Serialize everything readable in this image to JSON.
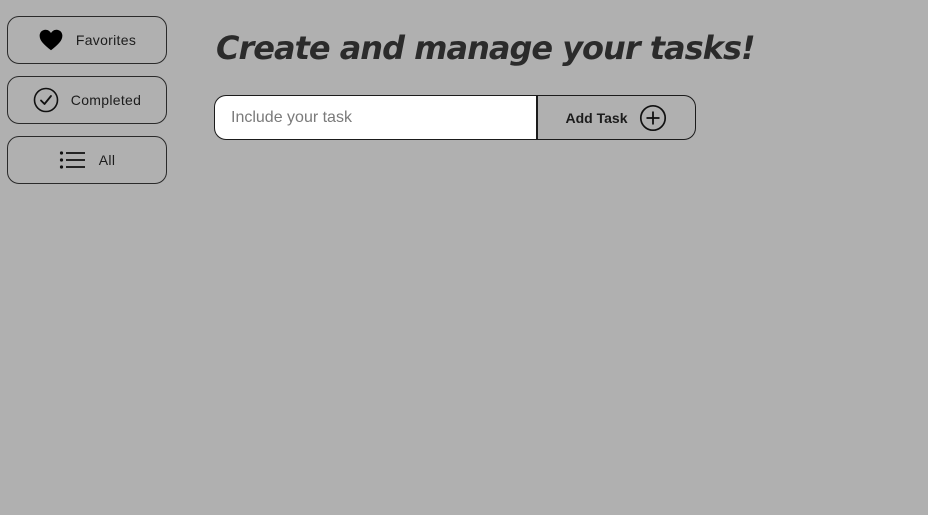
{
  "sidebar": {
    "items": [
      {
        "label": "Favorites",
        "icon": "heart-icon"
      },
      {
        "label": "Completed",
        "icon": "check-circle-icon"
      },
      {
        "label": "All",
        "icon": "list-icon"
      }
    ]
  },
  "main": {
    "title": "Create and manage your tasks!",
    "task_input": {
      "placeholder": "Include your task",
      "value": ""
    },
    "add_button": {
      "label": "Add Task",
      "icon": "plus-circle-icon"
    }
  },
  "colors": {
    "background": "#b0b0b0",
    "text": "#1f1f1f",
    "input_background": "#ffffff",
    "border": "#1b1b1b"
  }
}
